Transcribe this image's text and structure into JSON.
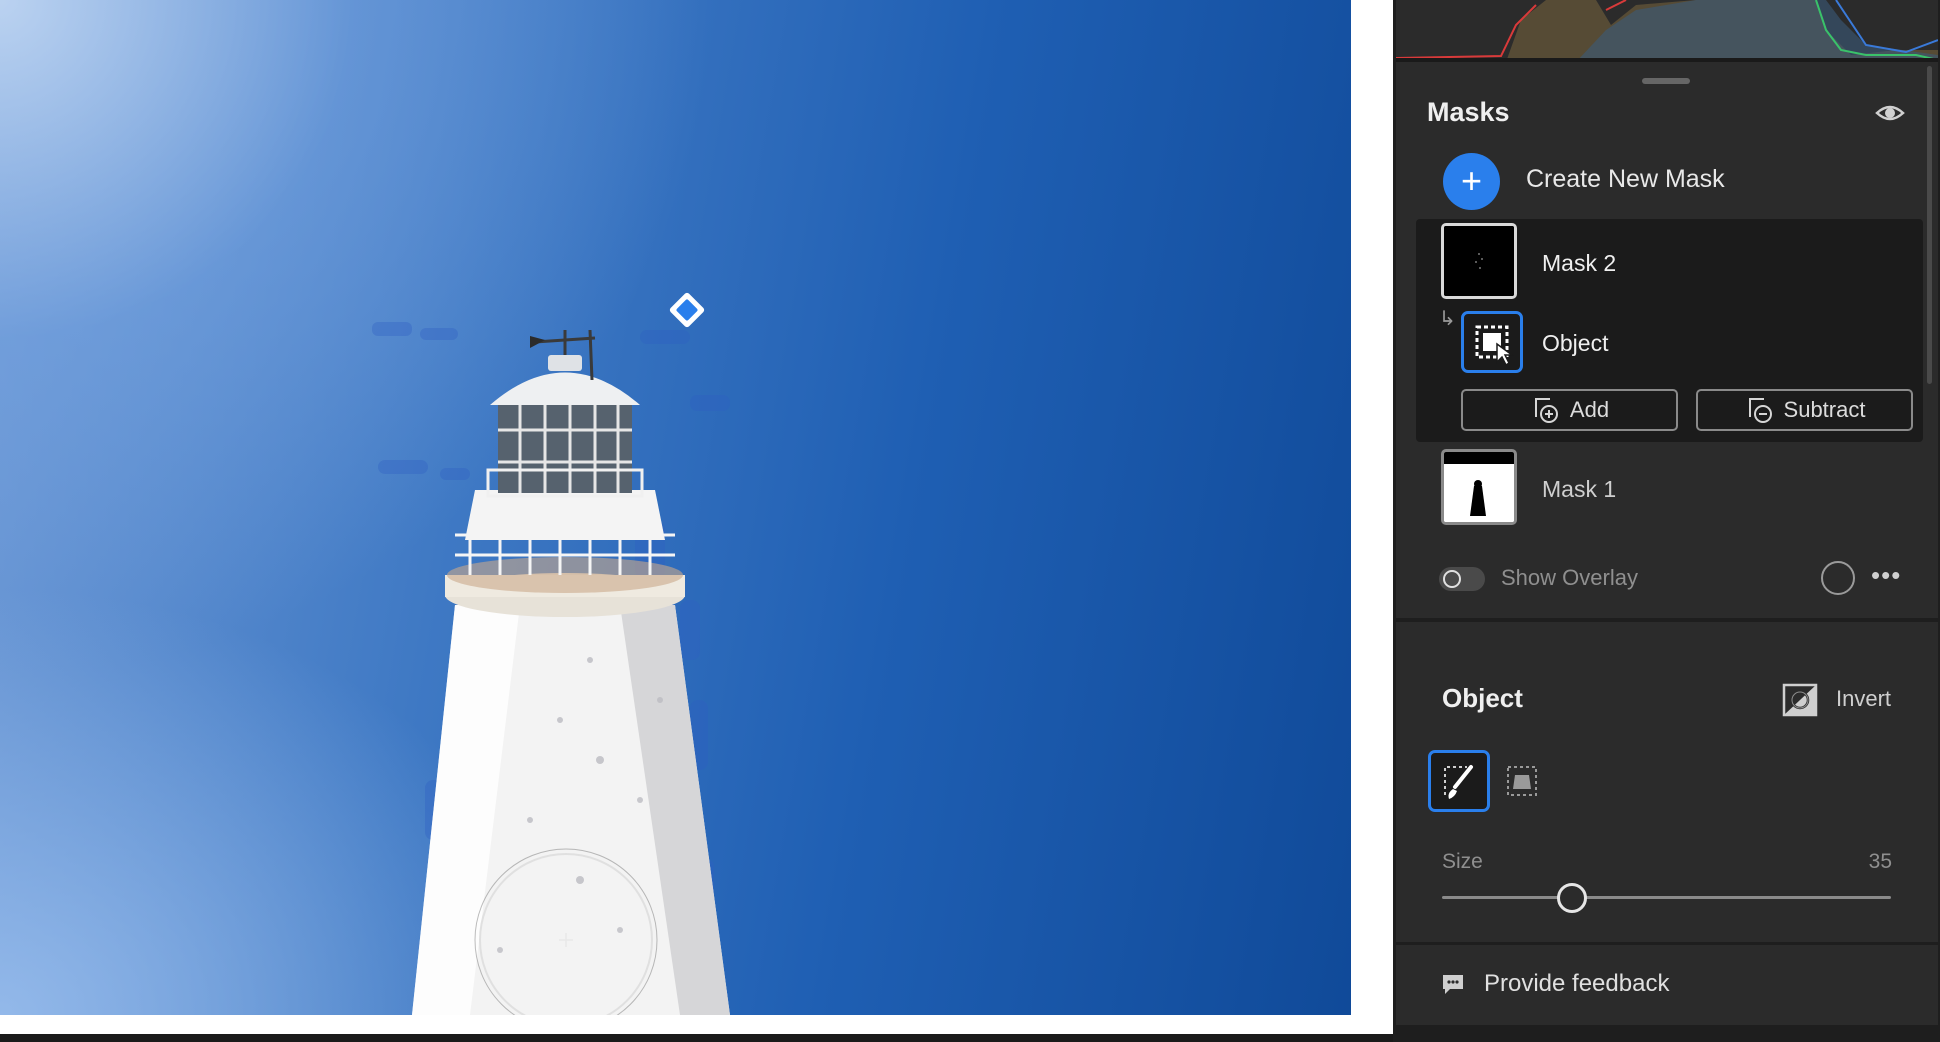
{
  "masks_panel": {
    "title": "Masks",
    "create_label": "Create New Mask",
    "create_icon": "+",
    "items": [
      {
        "label": "Mask 2"
      },
      {
        "label": "Object"
      },
      {
        "label": "Mask 1"
      }
    ],
    "add_label": "Add",
    "subtract_label": "Subtract",
    "overlay_label": "Show Overlay",
    "overlay_enabled": false,
    "more_label": "•••"
  },
  "object_panel": {
    "title": "Object",
    "invert_label": "Invert",
    "size_label": "Size",
    "size_value": "35",
    "size_fraction": 0.29
  },
  "feedback": {
    "label": "Provide feedback"
  },
  "colors": {
    "accent": "#2a7fec",
    "panel_bg": "#2b2b2b",
    "app_bg": "#1e1e1e",
    "sky_light": "#9cc0ee",
    "sky_dark": "#104a99"
  },
  "icons": {
    "eye": "eye-icon",
    "arrow": "sub-mask-arrow-icon",
    "object_select": "object-select-icon",
    "brush": "brush-icon",
    "rect_select": "rectangle-select-icon",
    "feedback": "speech-bubble-icon"
  }
}
